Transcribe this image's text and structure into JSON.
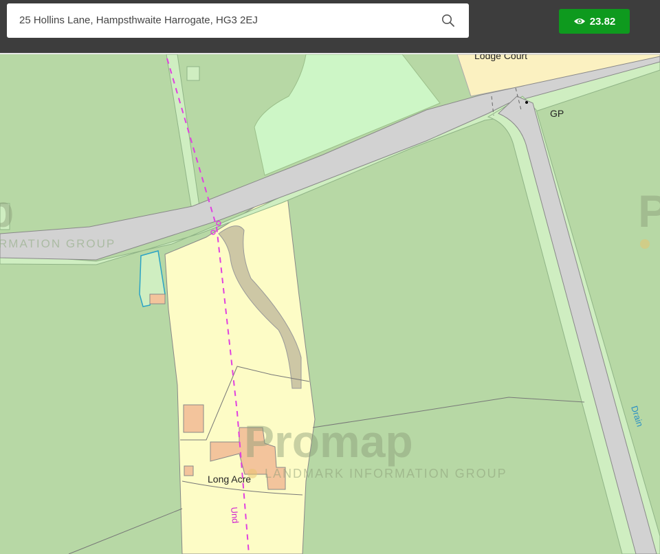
{
  "search": {
    "value": "25 Hollins Lane, Hampsthwaite Harrogate, HG3 2EJ",
    "icon": "search-icon"
  },
  "views_badge": {
    "value": "23.82",
    "icon": "eye-icon",
    "color": "#0e9a1e"
  },
  "map": {
    "labels": {
      "lodge_court": "Lodge Court",
      "gp": "GP",
      "drain": "Drain",
      "long_acre": "Long Acre",
      "und": "Und"
    },
    "watermark": {
      "brand": "Promap",
      "brand_tagline": "LANDMARK INFORMATION GROUP",
      "left_partial": "RMATION GROUP"
    },
    "colors": {
      "field": "#b7d8a5",
      "road": "#d2d2d2",
      "verge": "#cfeec1",
      "plot": "#fdfcc6",
      "track": "#cdc7a5",
      "building": "#f3c49c",
      "footpath": "#e040e0",
      "lodge": "#fbf1c1"
    }
  }
}
